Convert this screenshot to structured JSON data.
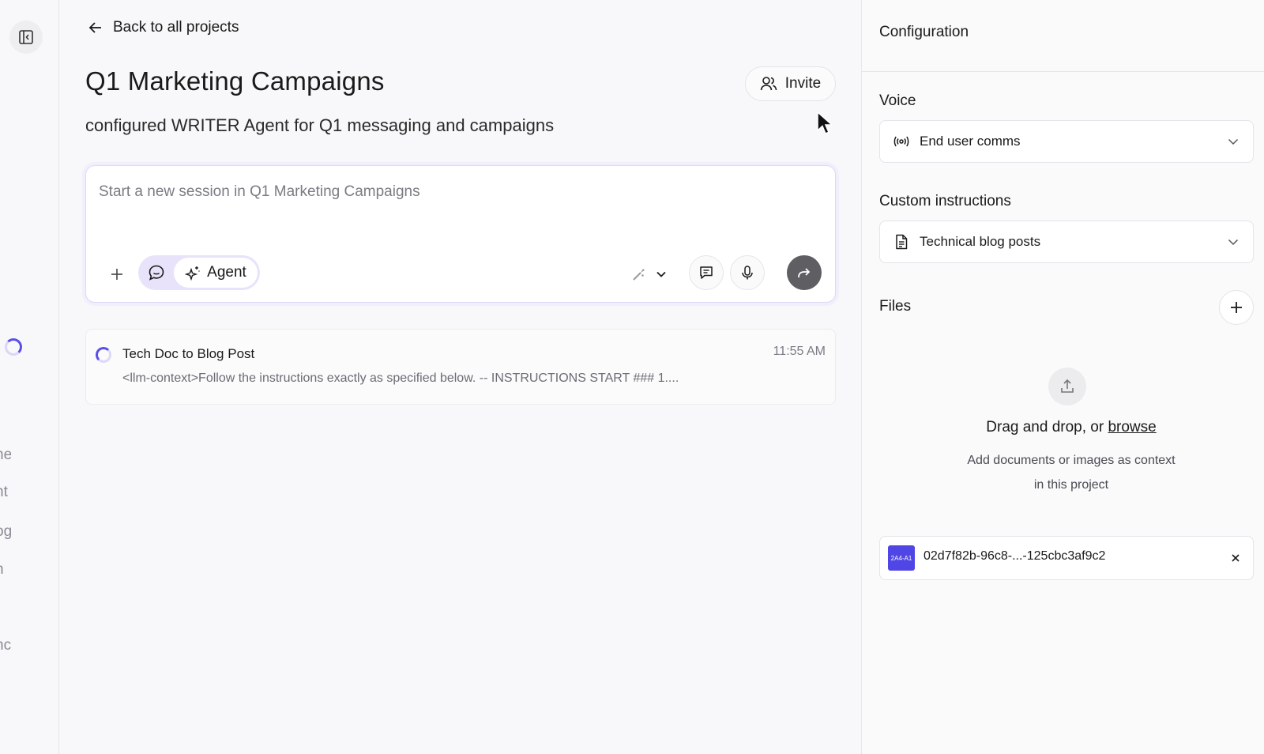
{
  "nav": {
    "back_label": "Back to all projects",
    "rail_fragments": [
      "ne",
      "nt",
      "og",
      "n",
      "nc"
    ]
  },
  "project": {
    "title": "Q1 Marketing Campaigns",
    "subtitle": "configured WRITER Agent for Q1 messaging and campaigns",
    "invite_label": "Invite"
  },
  "composer": {
    "placeholder": "Start a new session in Q1 Marketing Campaigns",
    "mode_label": "Agent",
    "icons": [
      "plus-icon",
      "chat-bubble-icon",
      "sparkle-icon",
      "tools-icon",
      "chevron-down-icon",
      "message-icon",
      "microphone-icon",
      "send-icon"
    ]
  },
  "sessions": [
    {
      "title": "Tech Doc to Blog Post",
      "time": "11:55 AM",
      "preview": "<llm-context>Follow the instructions exactly as specified below. -- INSTRUCTIONS START ### 1...."
    }
  ],
  "config": {
    "title": "Configuration",
    "voice_label": "Voice",
    "voice_value": "End user comms",
    "instructions_label": "Custom instructions",
    "instructions_value": "Technical blog posts",
    "files_label": "Files",
    "drop_prefix": "Drag and drop, or ",
    "drop_link": "browse",
    "drop_desc_1": "Add documents or images as context",
    "drop_desc_2": "in this project",
    "files": [
      {
        "thumb_text": "2A4-A1",
        "name": "02d7f82b-96c8-...-125cbc3af9c2"
      }
    ]
  },
  "colors": {
    "accent": "#5b4ee6",
    "mode_bg": "#e8e3fb",
    "send_bg": "#5e5e63",
    "file_thumb": "#4f46e5"
  }
}
